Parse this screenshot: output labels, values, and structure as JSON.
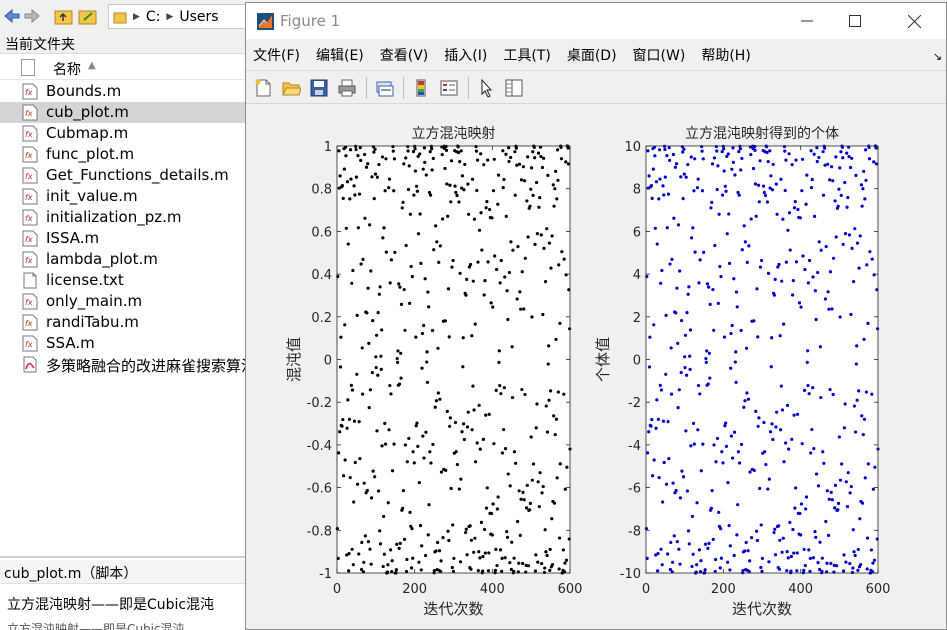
{
  "browser": {
    "path": [
      "C:",
      "Users"
    ],
    "current_folder_label": "当前文件夹",
    "column_name": "名称",
    "files": [
      {
        "name": "Bounds.m",
        "type": "m",
        "selected": false
      },
      {
        "name": "cub_plot.m",
        "type": "m",
        "selected": true
      },
      {
        "name": "Cubmap.m",
        "type": "m",
        "selected": false
      },
      {
        "name": "func_plot.m",
        "type": "m",
        "selected": false
      },
      {
        "name": "Get_Functions_details.m",
        "type": "m",
        "selected": false
      },
      {
        "name": "init_value.m",
        "type": "m",
        "selected": false
      },
      {
        "name": "initialization_pz.m",
        "type": "m",
        "selected": false
      },
      {
        "name": "ISSA.m",
        "type": "m",
        "selected": false
      },
      {
        "name": "lambda_plot.m",
        "type": "m",
        "selected": false
      },
      {
        "name": "license.txt",
        "type": "txt",
        "selected": false
      },
      {
        "name": "only_main.m",
        "type": "m",
        "selected": false
      },
      {
        "name": "randiTabu.m",
        "type": "m",
        "selected": false
      },
      {
        "name": "SSA.m",
        "type": "m",
        "selected": false
      },
      {
        "name": "多策略融合的改进麻雀搜索算法",
        "type": "pdf",
        "selected": false
      }
    ],
    "detail_title": "cub_plot.m（脚本）",
    "detail_description": "立方混沌映射——即是Cubic混沌",
    "detail_description2": "立方混沌映射——即是Cubic混沌"
  },
  "figure": {
    "title": "Figure 1",
    "menu": [
      "文件(F)",
      "编辑(E)",
      "查看(V)",
      "插入(I)",
      "工具(T)",
      "桌面(D)",
      "窗口(W)",
      "帮助(H)"
    ],
    "toolbar_icons": [
      "new-figure-icon",
      "open-icon",
      "save-icon",
      "print-icon",
      "link-icon",
      "colorbar-icon",
      "legend-icon",
      "pointer-icon",
      "property-editor-icon"
    ]
  },
  "chart_data": [
    {
      "type": "scatter",
      "title": "立方混沌映射",
      "xlabel": "迭代次数",
      "ylabel": "混沌值",
      "xlim": [
        0,
        600
      ],
      "ylim": [
        -1,
        1
      ],
      "xticks": [
        0,
        200,
        400,
        600
      ],
      "yticks": [
        1,
        0.8,
        0.6,
        0.4,
        0.2,
        0,
        -0.2,
        -0.4,
        -0.6,
        -0.8,
        -1
      ],
      "color": "#000000",
      "series": [
        {
          "generator": "cubic_map",
          "x0": 0.3,
          "n": 600
        }
      ]
    },
    {
      "type": "scatter",
      "title": "立方混沌映射得到的个体",
      "xlabel": "迭代次数",
      "ylabel": "个体值",
      "xlim": [
        0,
        600
      ],
      "ylim": [
        -10,
        10
      ],
      "xticks": [
        0,
        200,
        400,
        600
      ],
      "yticks": [
        10,
        8,
        6,
        4,
        2,
        0,
        -2,
        -4,
        -6,
        -8,
        -10
      ],
      "color": "#0000cc",
      "series": [
        {
          "generator": "cubic_map_scaled",
          "scale": 10,
          "x0": 0.3,
          "n": 600
        }
      ]
    }
  ]
}
